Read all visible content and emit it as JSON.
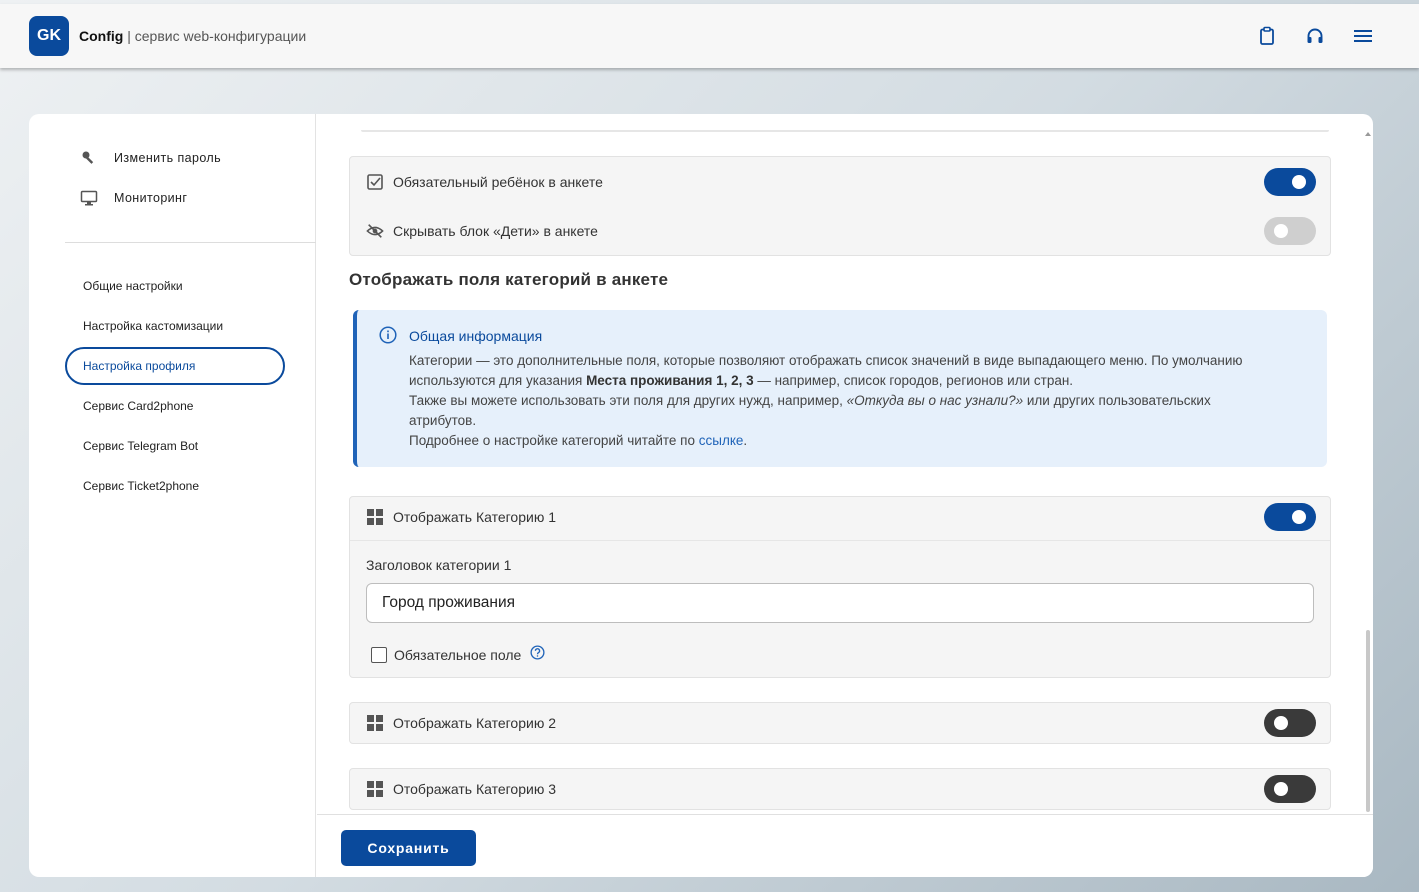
{
  "header": {
    "logo": "GK",
    "brand_name": "Config",
    "brand_separator": " | ",
    "brand_subtitle": "сервис web-конфигурации",
    "icons": [
      "clipboard-icon",
      "headset-icon",
      "menu-icon"
    ]
  },
  "sidebar": {
    "top_items": [
      {
        "label": "Изменить пароль",
        "icon": "key-icon"
      },
      {
        "label": "Мониторинг",
        "icon": "monitor-icon"
      }
    ],
    "items": [
      {
        "label": "Общие настройки"
      },
      {
        "label": "Настройка кастомизации"
      },
      {
        "label": "Настройка профиля"
      },
      {
        "label": "Сервис Card2phone"
      },
      {
        "label": "Сервис Telegram Bot"
      },
      {
        "label": "Сервис Ticket2phone"
      }
    ],
    "active_index": 2
  },
  "children_block": {
    "required_child": {
      "label": "Обязательный ребёнок в анкете",
      "on": true
    },
    "hide_children": {
      "label": "Скрывать блок «Дети» в анкете",
      "on": false
    }
  },
  "categories_section": {
    "title": "Отображать поля категорий в анкете",
    "info": {
      "heading": "Общая информация",
      "line1": "Категории — это дополнительные поля, которые позволяют отображать список значений в виде выпадающего меню. По умолчанию",
      "line2_pre": "используются для указания ",
      "line2_bold": "Места проживания 1, 2, 3",
      "line2_post": " — например, список городов, регионов или стран.",
      "line3_pre": "Также вы можете использовать эти поля для других нужд, например, ",
      "line3_italic": "«Откуда вы о нас узнали?»",
      "line3_post": " или других пользовательских",
      "line4": "атрибутов.",
      "line5_pre": "Подробнее о настройке категорий читайте по ",
      "line5_link": "ссылке",
      "line5_post": "."
    },
    "category1": {
      "label": "Отображать Категорию 1",
      "on": true,
      "field_label": "Заголовок категории 1",
      "field_value": "Город проживания",
      "required_label": "Обязательное поле",
      "required_checked": false
    },
    "category2": {
      "label": "Отображать Категорию 2",
      "on": false
    },
    "category3": {
      "label": "Отображать Категорию 3",
      "on": false
    }
  },
  "footer": {
    "save_label": "Сохранить"
  },
  "colors": {
    "accent": "#0a4a9c",
    "info_bg": "#e6f0fb",
    "link": "#1f63b8"
  }
}
